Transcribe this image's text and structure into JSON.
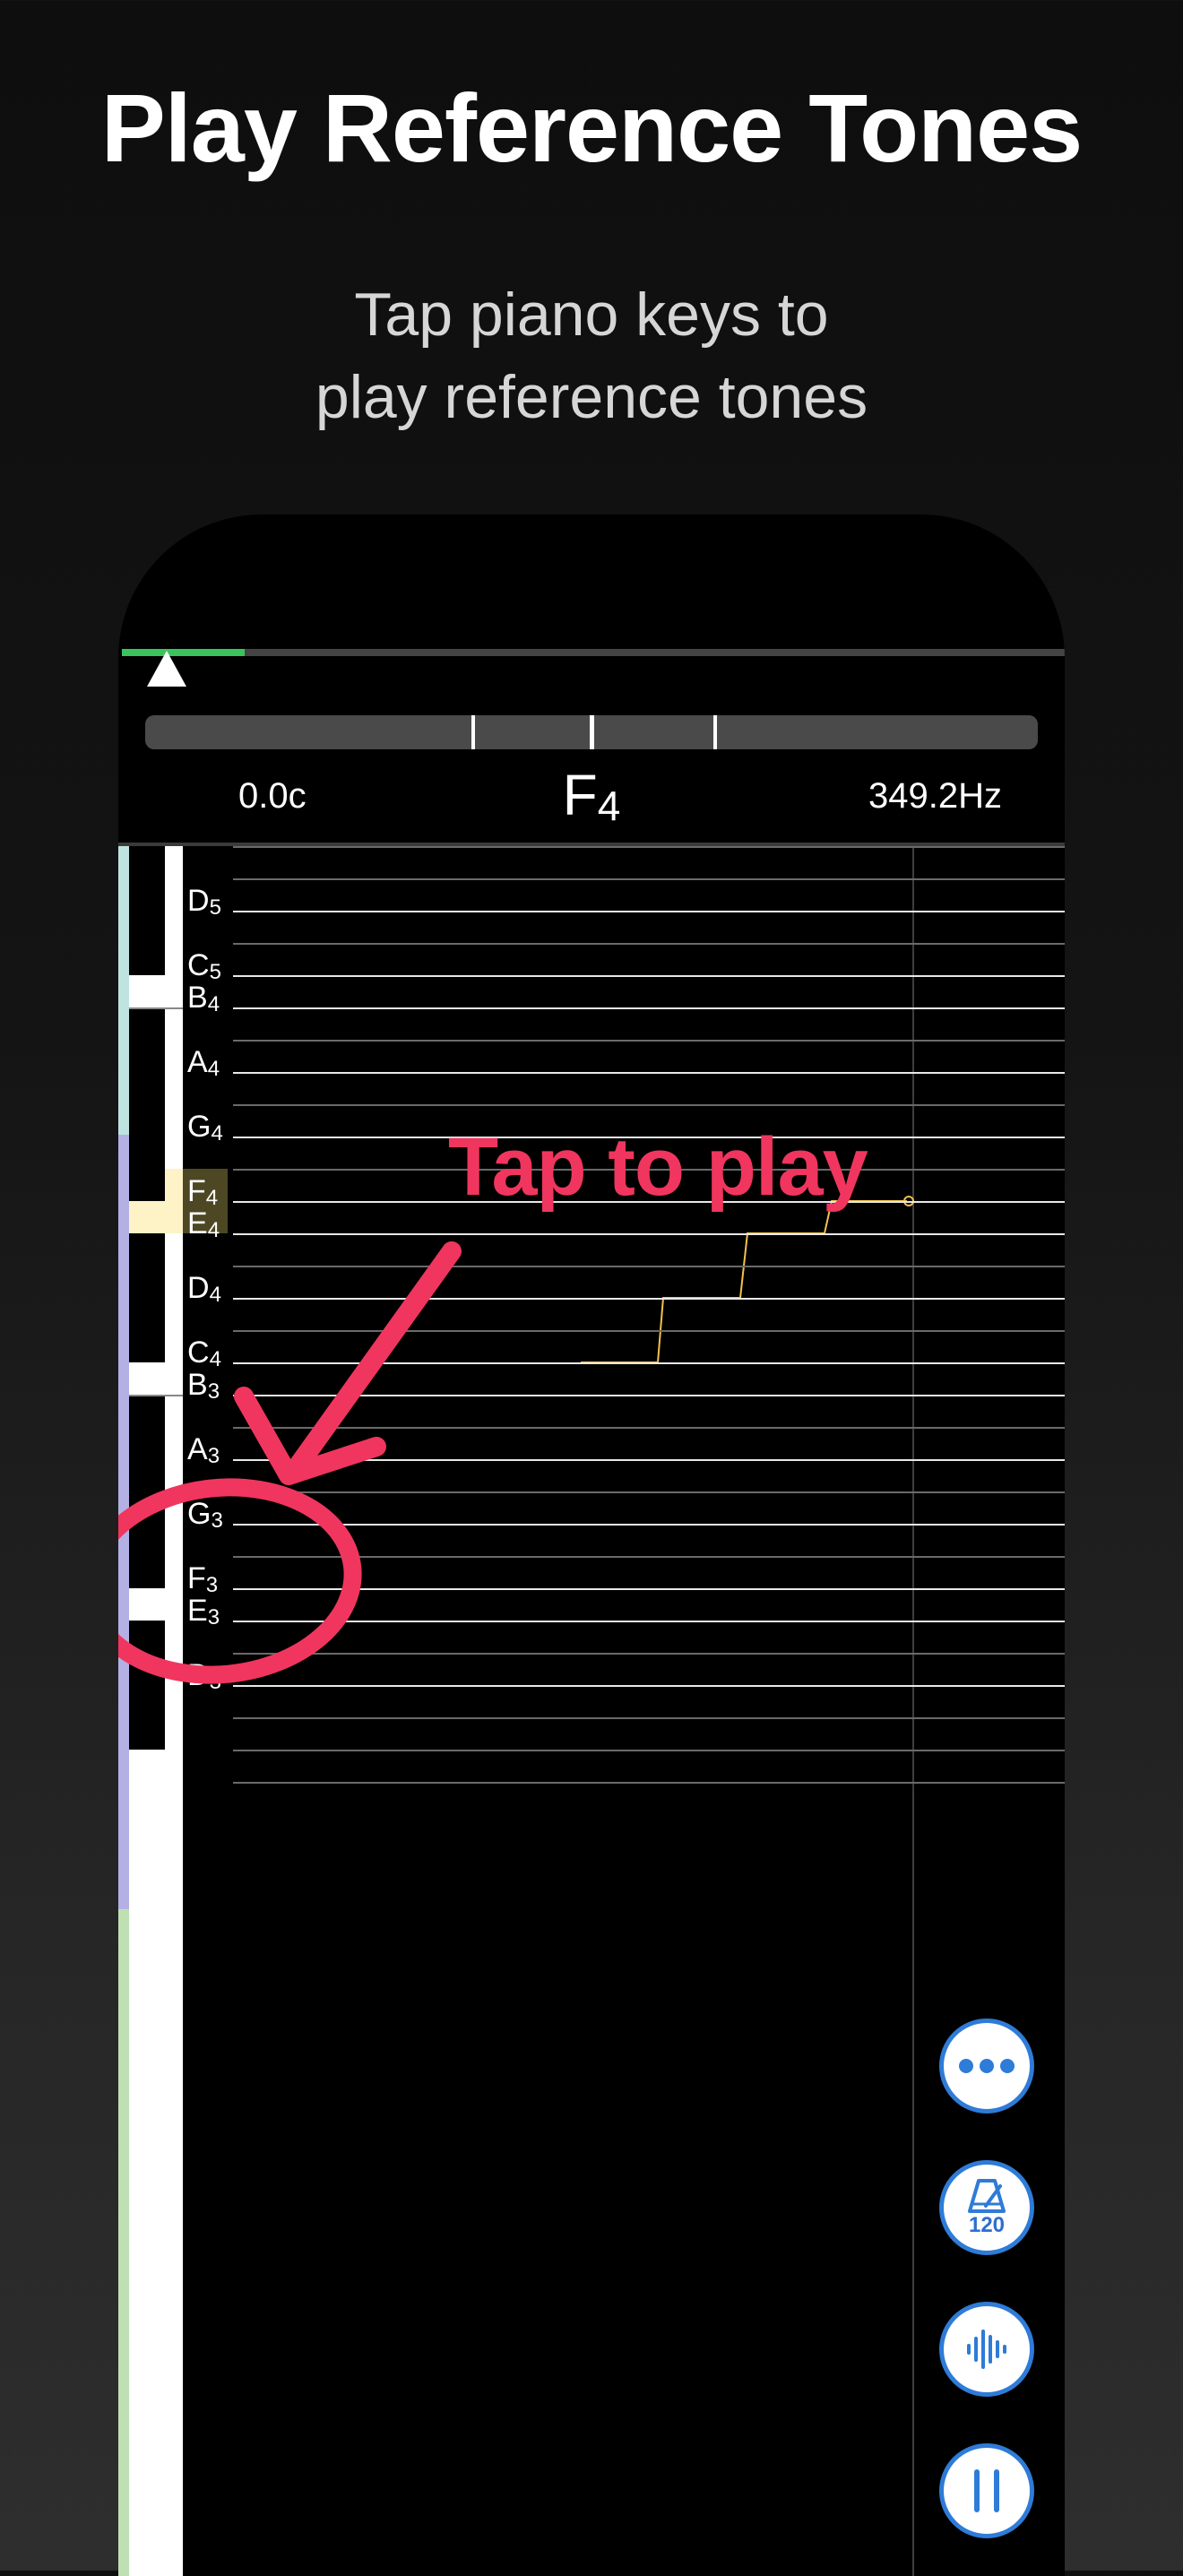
{
  "headline": "Play Reference Tones",
  "subline": [
    "Tap piano keys to",
    "play reference tones"
  ],
  "tuner": {
    "cents": "0.0c",
    "note_letter": "F",
    "note_octave": "4",
    "frequency": "349.2Hz",
    "playback_progress": 0.13
  },
  "notes": [
    {
      "letter": "D",
      "octave": "5"
    },
    {
      "letter": "C",
      "octave": "5"
    },
    {
      "letter": "B",
      "octave": "4"
    },
    {
      "letter": "A",
      "octave": "4"
    },
    {
      "letter": "G",
      "octave": "4"
    },
    {
      "letter": "F",
      "octave": "4"
    },
    {
      "letter": "E",
      "octave": "4"
    },
    {
      "letter": "D",
      "octave": "4"
    },
    {
      "letter": "C",
      "octave": "4"
    },
    {
      "letter": "B",
      "octave": "3"
    },
    {
      "letter": "A",
      "octave": "3"
    },
    {
      "letter": "G",
      "octave": "3"
    },
    {
      "letter": "F",
      "octave": "3"
    },
    {
      "letter": "E",
      "octave": "3"
    },
    {
      "letter": "D",
      "octave": "3"
    }
  ],
  "active_note": {
    "letter": "F",
    "octave": "4"
  },
  "annotation": "Tap to play",
  "buttons": {
    "more_icon": "ellipsis-icon",
    "metronome_bpm": "120",
    "waveform_icon": "waveform-icon",
    "pause_icon": "pause-icon"
  },
  "colors": {
    "accent": "#f0365e",
    "pitch_line": "#f2c14e",
    "progress": "#3bc45d",
    "button_blue": "#2e7bd8"
  }
}
